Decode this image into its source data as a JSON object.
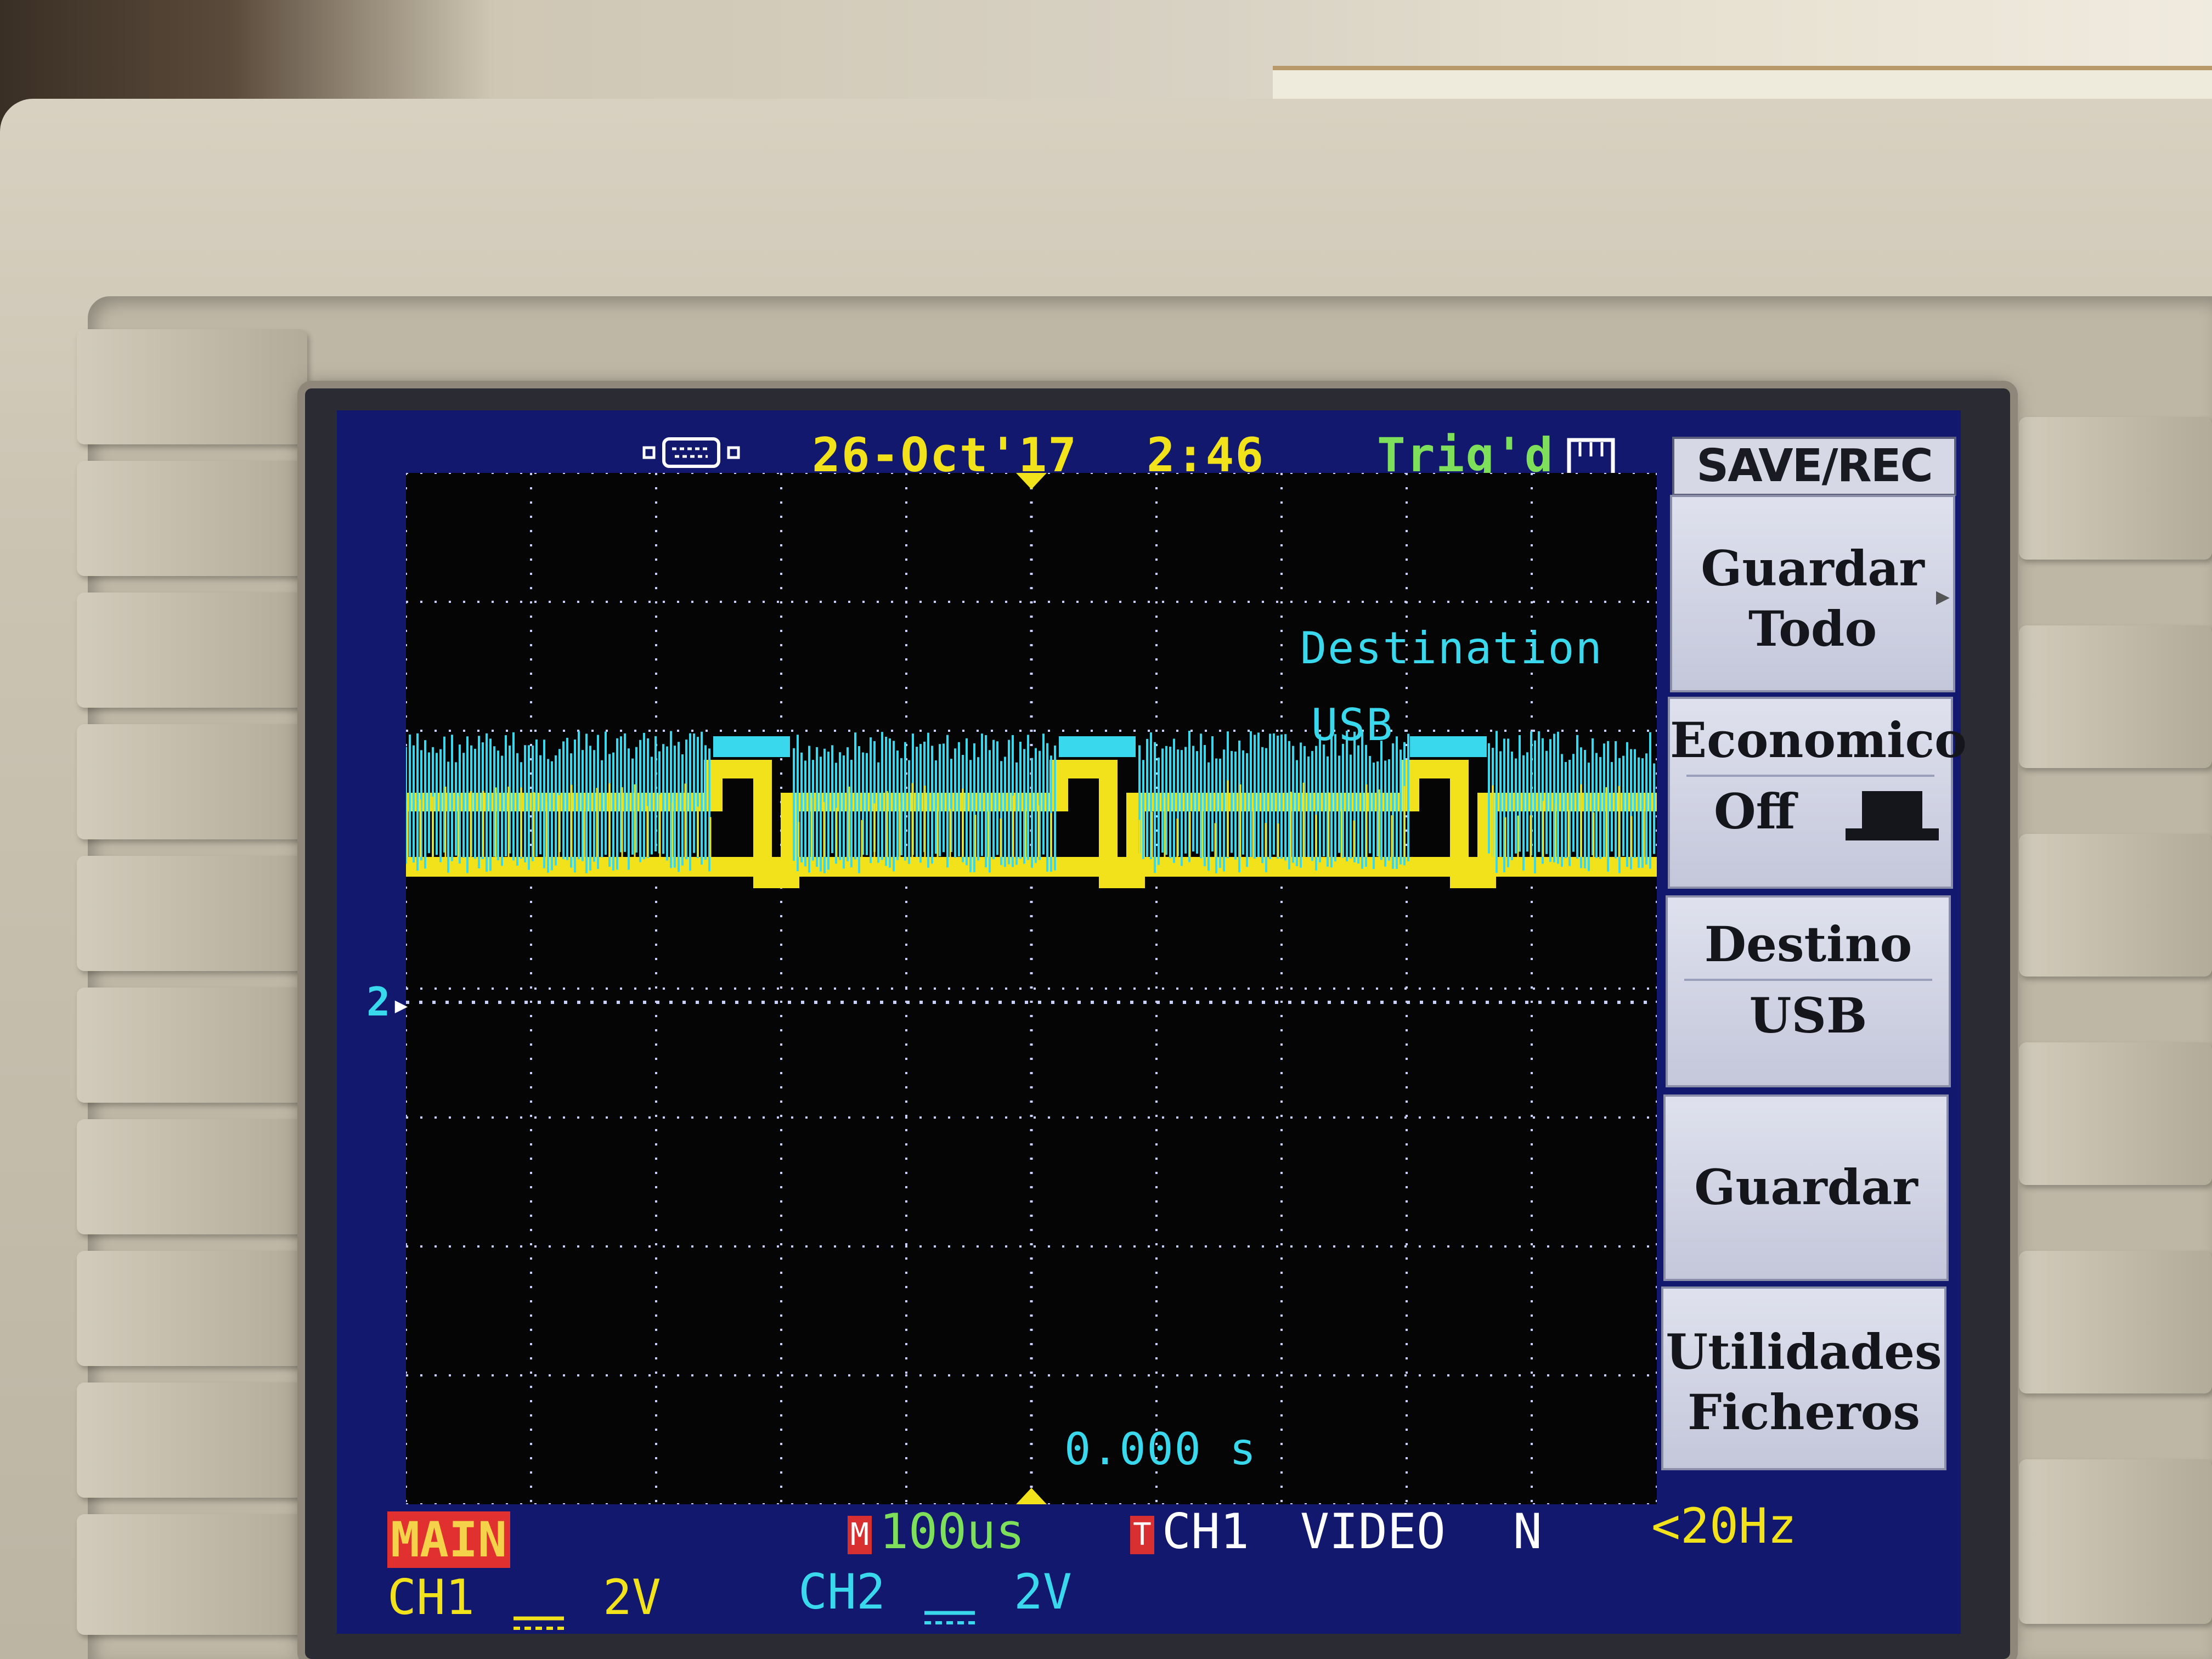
{
  "status_bar": {
    "usb_icon": "usb-connector-icon",
    "date": "26-Oct'17",
    "time": "2:46",
    "trigger_status": "Trig'd",
    "trigger_icon": "trigger-pulse-icon"
  },
  "overlay": {
    "destination_label": "Destination",
    "destination_value": "USB",
    "time_offset": "0.000 s",
    "ch2_marker": "2"
  },
  "menu": {
    "title": "SAVE/REC",
    "buttons": [
      {
        "line1": "Guardar",
        "line2": "Todo"
      },
      {
        "line1": "Economico",
        "line2": "Off"
      },
      {
        "line1": "Destino",
        "line2": "USB"
      },
      {
        "line1": "Guardar",
        "line2": ""
      },
      {
        "line1": "Utilidades",
        "line2": "Ficheros"
      }
    ]
  },
  "bottom": {
    "mode": "MAIN",
    "timebase_marker": "M",
    "timebase": "100us",
    "trigger_marker": "T",
    "trigger_source": "CH1",
    "trigger_type": "VIDEO",
    "trigger_polarity": "N",
    "trigger_freq": "<20Hz",
    "ch1_label": "CH1",
    "ch1_scale": "2V",
    "ch2_label": "CH2",
    "ch2_scale": "2V",
    "coupling_icon": "dc-coupling-icon"
  },
  "colors": {
    "ch1": "#f2e21c",
    "ch2": "#3ad8ec",
    "screen_bg": "#12186e",
    "grid": "#c8d0ff",
    "date": "#f2e21c",
    "trigger_status": "#7ee05a",
    "bottom_red": "#e03030"
  }
}
